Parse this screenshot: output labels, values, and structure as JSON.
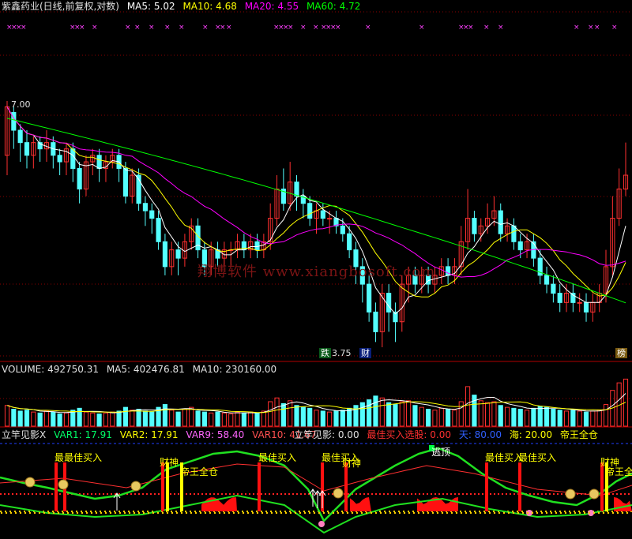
{
  "main_header": {
    "title": "紫鑫药业(日线,前复权,对数)",
    "ma5": "MA5: 5.02",
    "ma10": "MA10: 4.68",
    "ma20": "MA20: 4.55",
    "ma60": "MA60: 4.72"
  },
  "price_labels": {
    "high": "7.00",
    "low": "3.75"
  },
  "badges": {
    "drop": "跌",
    "wealth": "财",
    "top": "榜"
  },
  "watermark": "翔博软件  www.xiangbosoft.com",
  "volume_header": {
    "volume": "VOLUME: 492750.31",
    "ma5": "MA5: 402476.81",
    "ma10": "MA10: 230160.00"
  },
  "indicator_header": {
    "name": "立竿见影X",
    "var1": "VAR1: 17.91",
    "var2": "VAR2: 17.91",
    "var9": "VAR9: 58.40",
    "var10": "VAR10: 41.67",
    "name2": "立竿见影: 0.00",
    "best_buy": "最佳买入选股: 0.00",
    "sky": "天: 80.00",
    "sea": "海: 20.00",
    "emperor": "帝王全仓"
  },
  "signal_labels": {
    "best_buy": "最佳买入",
    "best_buy_dup": "最最佳买入",
    "wealth_god": "财神",
    "emperor_full": "帝王全仓",
    "escape_top": "逃顶"
  },
  "colors": {
    "ma5": "#ffffff",
    "ma10": "#ffff00",
    "ma20": "#ff00ff",
    "ma60": "#00ff00",
    "up": "#ff3030",
    "down": "#54ffff",
    "grid": "#8a0000"
  },
  "chart_data": {
    "type": "candlestick",
    "candles": [
      [
        6.1,
        6.9,
        7.0,
        5.8
      ],
      [
        6.8,
        6.5,
        6.9,
        6.2
      ],
      [
        6.5,
        6.3,
        6.6,
        6.0
      ],
      [
        6.3,
        6.1,
        6.5,
        5.9
      ],
      [
        6.1,
        6.3,
        6.4,
        5.9
      ],
      [
        6.3,
        6.2,
        6.4,
        6.0
      ],
      [
        6.2,
        6.3,
        6.5,
        6.0
      ],
      [
        6.3,
        6.1,
        6.4,
        5.9
      ],
      [
        6.1,
        6.0,
        6.2,
        5.8
      ],
      [
        6.0,
        6.2,
        6.3,
        5.8
      ],
      [
        6.2,
        5.9,
        6.3,
        5.7
      ],
      [
        5.9,
        5.6,
        6.0,
        5.4
      ],
      [
        5.6,
        6.0,
        6.1,
        5.5
      ],
      [
        6.0,
        6.1,
        6.2,
        5.8
      ],
      [
        6.1,
        5.9,
        6.2,
        5.7
      ],
      [
        5.9,
        6.0,
        6.1,
        5.7
      ],
      [
        6.0,
        6.1,
        6.2,
        5.9
      ],
      [
        6.1,
        5.9,
        6.2,
        5.7
      ],
      [
        5.9,
        5.5,
        6.0,
        5.4
      ],
      [
        5.5,
        5.8,
        5.9,
        5.4
      ],
      [
        5.8,
        5.4,
        5.9,
        5.3
      ],
      [
        5.4,
        5.3,
        5.5,
        5.1
      ],
      [
        5.3,
        5.2,
        5.4,
        5.0
      ],
      [
        5.2,
        4.9,
        5.3,
        4.8
      ],
      [
        4.9,
        4.6,
        5.0,
        4.5
      ],
      [
        4.6,
        4.8,
        4.9,
        4.5
      ],
      [
        4.8,
        4.7,
        4.9,
        4.5
      ],
      [
        4.7,
        4.9,
        5.0,
        4.6
      ],
      [
        4.9,
        5.1,
        5.2,
        4.8
      ],
      [
        5.1,
        4.8,
        5.2,
        4.7
      ],
      [
        4.8,
        4.6,
        4.9,
        4.5
      ],
      [
        4.6,
        4.8,
        4.9,
        4.5
      ],
      [
        4.8,
        4.7,
        4.9,
        4.6
      ],
      [
        4.7,
        4.8,
        4.9,
        4.6
      ],
      [
        4.8,
        4.8,
        4.9,
        4.6
      ],
      [
        4.8,
        4.9,
        5.0,
        4.7
      ],
      [
        4.9,
        4.8,
        5.0,
        4.7
      ],
      [
        4.8,
        4.9,
        5.0,
        4.7
      ],
      [
        4.9,
        4.8,
        5.0,
        4.7
      ],
      [
        4.8,
        4.9,
        5.0,
        4.7
      ],
      [
        4.9,
        5.2,
        5.4,
        4.8
      ],
      [
        5.2,
        5.6,
        5.8,
        5.1
      ],
      [
        5.6,
        5.4,
        5.9,
        5.3
      ],
      [
        5.4,
        5.7,
        6.0,
        5.3
      ],
      [
        5.7,
        5.5,
        5.8,
        5.3
      ],
      [
        5.5,
        5.4,
        5.6,
        5.2
      ],
      [
        5.4,
        5.2,
        5.5,
        5.1
      ],
      [
        5.2,
        5.3,
        5.4,
        5.0
      ],
      [
        5.3,
        5.2,
        5.4,
        5.1
      ],
      [
        5.2,
        5.2,
        5.3,
        5.0
      ],
      [
        5.2,
        5.1,
        5.3,
        5.0
      ],
      [
        5.1,
        5.0,
        5.2,
        4.9
      ],
      [
        5.0,
        4.8,
        5.1,
        4.7
      ],
      [
        4.8,
        4.6,
        4.9,
        4.4
      ],
      [
        4.6,
        4.4,
        4.7,
        4.2
      ],
      [
        4.4,
        4.1,
        4.5,
        4.0
      ],
      [
        4.1,
        3.9,
        4.2,
        3.8
      ],
      [
        3.9,
        4.3,
        4.4,
        3.75
      ],
      [
        4.3,
        4.1,
        4.4,
        3.9
      ],
      [
        4.1,
        4.0,
        4.2,
        3.8
      ],
      [
        4.0,
        4.4,
        4.5,
        3.9
      ],
      [
        4.4,
        4.5,
        4.6,
        4.2
      ],
      [
        4.5,
        4.4,
        4.6,
        4.3
      ],
      [
        4.4,
        4.5,
        4.6,
        4.3
      ],
      [
        4.5,
        4.4,
        4.6,
        4.3
      ],
      [
        4.4,
        4.5,
        4.6,
        4.3
      ],
      [
        4.5,
        4.6,
        4.7,
        4.4
      ],
      [
        4.6,
        4.5,
        4.7,
        4.4
      ],
      [
        4.5,
        4.6,
        4.7,
        4.4
      ],
      [
        4.6,
        4.9,
        5.1,
        4.5
      ],
      [
        4.9,
        5.2,
        5.6,
        4.8
      ],
      [
        5.2,
        5.0,
        5.3,
        4.9
      ],
      [
        5.0,
        5.1,
        5.2,
        4.9
      ],
      [
        5.1,
        5.2,
        5.4,
        5.0
      ],
      [
        5.2,
        5.3,
        5.5,
        5.1
      ],
      [
        5.3,
        5.0,
        5.4,
        4.9
      ],
      [
        5.0,
        5.1,
        5.2,
        4.9
      ],
      [
        5.1,
        4.9,
        5.2,
        4.8
      ],
      [
        4.9,
        4.8,
        5.0,
        4.7
      ],
      [
        4.8,
        4.9,
        5.0,
        4.7
      ],
      [
        4.9,
        4.7,
        5.0,
        4.6
      ],
      [
        4.7,
        4.5,
        4.8,
        4.4
      ],
      [
        4.5,
        4.4,
        4.6,
        4.3
      ],
      [
        4.4,
        4.3,
        4.5,
        4.2
      ],
      [
        4.3,
        4.2,
        4.4,
        4.1
      ],
      [
        4.2,
        4.3,
        4.4,
        4.1
      ],
      [
        4.3,
        4.2,
        4.4,
        4.1
      ],
      [
        4.2,
        4.2,
        4.3,
        4.1
      ],
      [
        4.2,
        4.1,
        4.3,
        4.0
      ],
      [
        4.1,
        4.2,
        4.3,
        4.0
      ],
      [
        4.2,
        4.3,
        4.4,
        4.1
      ],
      [
        4.3,
        4.6,
        4.8,
        4.2
      ],
      [
        4.6,
        5.2,
        5.5,
        4.5
      ],
      [
        5.2,
        5.6,
        5.9,
        5.1
      ],
      [
        5.6,
        5.8,
        6.3,
        5.5
      ]
    ],
    "volume": [
      220,
      180,
      160,
      170,
      150,
      140,
      160,
      150,
      130,
      140,
      170,
      190,
      150,
      140,
      130,
      140,
      150,
      160,
      200,
      170,
      180,
      160,
      150,
      200,
      230,
      170,
      150,
      180,
      200,
      160,
      150,
      140,
      150,
      140,
      130,
      150,
      140,
      150,
      140,
      160,
      260,
      300,
      240,
      270,
      220,
      200,
      190,
      170,
      160,
      150,
      160,
      170,
      190,
      220,
      250,
      280,
      320,
      300,
      250,
      230,
      260,
      270,
      220,
      200,
      180,
      170,
      190,
      180,
      170,
      260,
      420,
      330,
      270,
      250,
      260,
      220,
      200,
      190,
      180,
      170,
      190,
      210,
      200,
      180,
      170,
      160,
      170,
      160,
      150,
      160,
      170,
      230,
      380,
      460,
      500
    ]
  }
}
